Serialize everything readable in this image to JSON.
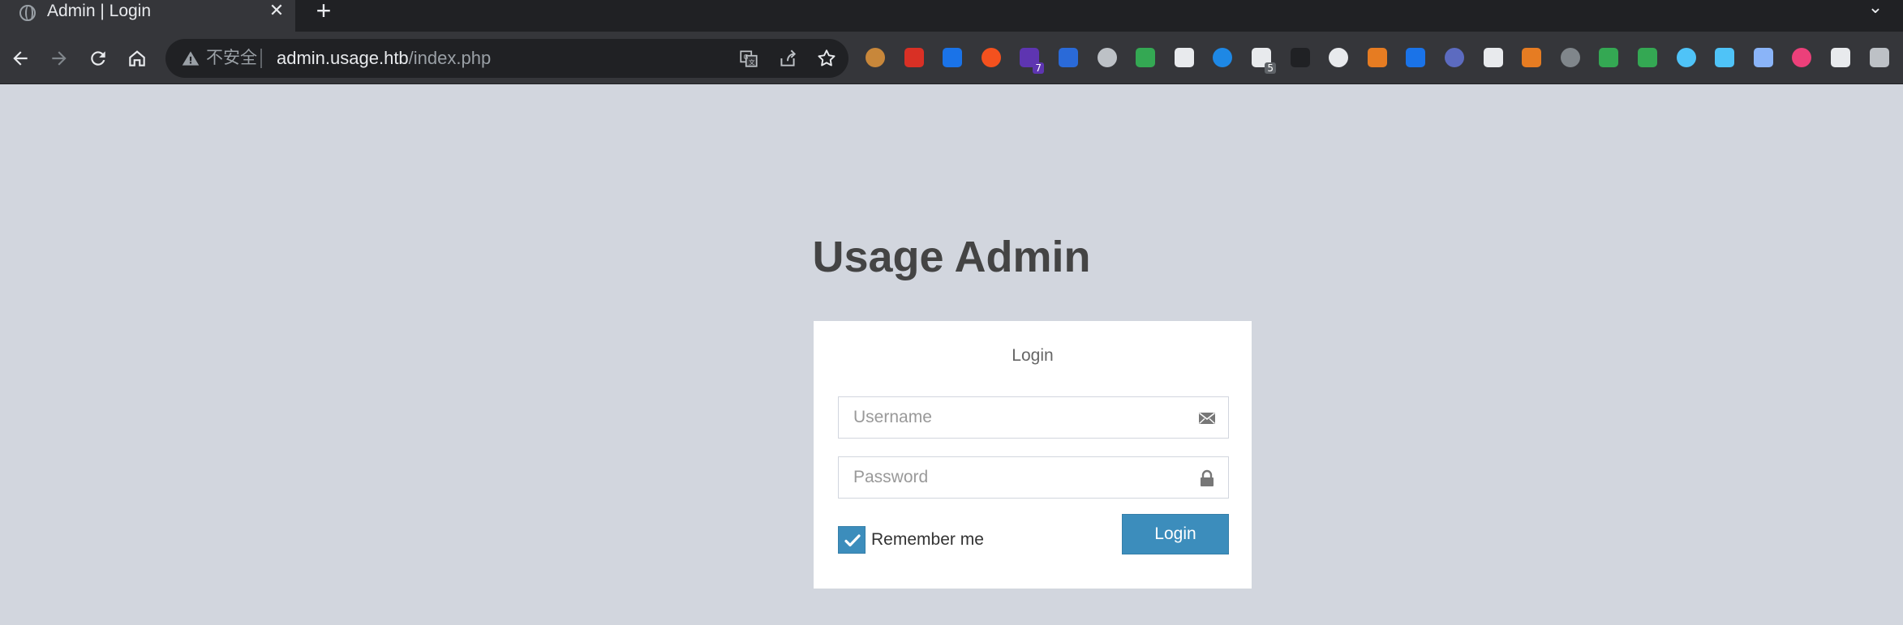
{
  "browser": {
    "tab": {
      "title": "Admin | Login",
      "close": "✕"
    },
    "new_tab": "+",
    "tab_search": "⌄",
    "omnibox": {
      "security_label": "不安全",
      "url_host": "admin.usage.htb",
      "url_path": "/index.php"
    },
    "extensions": [
      {
        "name": "cookie-extension-icon",
        "color": "#c8873a",
        "badge": ""
      },
      {
        "name": "dice-extension-icon",
        "color": "#d93025",
        "badge": ""
      },
      {
        "name": "glasses-extension-icon",
        "color": "#1a73e8",
        "badge": ""
      },
      {
        "name": "translate-extension-icon",
        "color": "#f4511e",
        "badge": ""
      },
      {
        "name": "purple-extension-icon",
        "color": "#5e35b1",
        "badge": "7"
      },
      {
        "name": "firefox-extension-icon",
        "color": "#2a6ad8",
        "badge": ""
      },
      {
        "name": "cloud-extension-icon",
        "color": "#bdc1c6",
        "badge": ""
      },
      {
        "name": "globe-extension-icon",
        "color": "#34a853",
        "badge": ""
      },
      {
        "name": "ip-extension-icon",
        "color": "#e8eaed",
        "badge": ""
      },
      {
        "name": "wave-extension-icon",
        "color": "#1e88e5",
        "badge": ""
      },
      {
        "name": "qr-extension-icon",
        "color": "#e8eaed",
        "badge": "5"
      },
      {
        "name": "hat-extension-icon",
        "color": "#202124",
        "badge": ""
      },
      {
        "name": "mask-extension-icon",
        "color": "#e8eaed",
        "badge": ""
      },
      {
        "name": "shield-extension-icon",
        "color": "#e67c22",
        "badge": ""
      },
      {
        "name": "bars-extension-icon",
        "color": "#1a73e8",
        "badge": ""
      },
      {
        "name": "moon-extension-icon",
        "color": "#5c6bc0",
        "badge": ""
      },
      {
        "name": "spy-extension-icon",
        "color": "#e8eaed",
        "badge": ""
      },
      {
        "name": "arrow-extension-icon",
        "color": "#e67c22",
        "badge": ""
      },
      {
        "name": "copy-extension-icon",
        "color": "#80868b",
        "badge": ""
      },
      {
        "name": "gear-extension-icon",
        "color": "#34a853",
        "badge": ""
      },
      {
        "name": "grid-extension-icon",
        "color": "#34a853",
        "badge": ""
      },
      {
        "name": "diamond-extension-icon",
        "color": "#4fc3f7",
        "badge": ""
      },
      {
        "name": "monitor-extension-icon",
        "color": "#4fc3f7",
        "badge": ""
      },
      {
        "name": "star-extension-icon",
        "color": "#8ab4f8",
        "badge": ""
      },
      {
        "name": "lang-extension-icon",
        "color": "#ec407a",
        "badge": ""
      },
      {
        "name": "s-extension-icon",
        "color": "#e8eaed",
        "badge": ""
      },
      {
        "name": "circle-extension-icon",
        "color": "#bdc1c6",
        "badge": ""
      }
    ]
  },
  "page": {
    "logo": "Usage Admin",
    "box_message": "Login",
    "username_placeholder": "Username",
    "password_placeholder": "Password",
    "remember_label": "Remember me",
    "remember_checked": true,
    "login_button": "Login",
    "accent_color": "#3c8dbc",
    "background_color": "#d2d6de"
  }
}
